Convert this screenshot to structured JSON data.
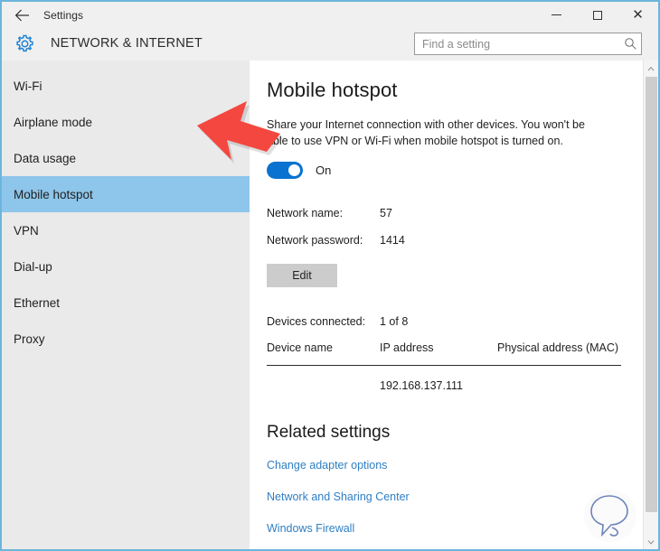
{
  "window": {
    "title": "Settings",
    "back_icon": "back-arrow-icon",
    "controls": {
      "minimize": "minimize-icon",
      "maximize": "maximize-icon",
      "close": "close-icon"
    }
  },
  "header": {
    "gear_icon": "gear-icon",
    "page_title": "NETWORK & INTERNET"
  },
  "search": {
    "placeholder": "Find a setting",
    "value": "",
    "icon": "search-icon"
  },
  "sidebar": {
    "items": [
      {
        "label": "Wi-Fi",
        "selected": false
      },
      {
        "label": "Airplane mode",
        "selected": false
      },
      {
        "label": "Data usage",
        "selected": false
      },
      {
        "label": "Mobile hotspot",
        "selected": true
      },
      {
        "label": "VPN",
        "selected": false
      },
      {
        "label": "Dial-up",
        "selected": false
      },
      {
        "label": "Ethernet",
        "selected": false
      },
      {
        "label": "Proxy",
        "selected": false
      }
    ],
    "selected_color": "#8ec5ea",
    "background": "#eaeaea"
  },
  "main": {
    "heading": "Mobile hotspot",
    "description": "Share your Internet connection with other devices. You won't be able to use VPN or Wi-Fi when mobile hotspot is turned on.",
    "toggle": {
      "state_label": "On",
      "checked": true,
      "color": "#0a72d0"
    },
    "details": [
      {
        "label": "Network name:",
        "value": "57"
      },
      {
        "label": "Network password:",
        "value": "1414"
      }
    ],
    "edit_button": "Edit",
    "devices": {
      "count_label": "Devices connected:",
      "count_value": "1 of 8",
      "columns": [
        "Device name",
        "IP address",
        "Physical address (MAC)"
      ],
      "rows": [
        {
          "device_name": "",
          "ip_address": "192.168.137.111",
          "mac": ""
        }
      ]
    },
    "related": {
      "heading": "Related settings",
      "links": [
        "Change adapter options",
        "Network and Sharing Center",
        "Windows Firewall"
      ],
      "link_color": "#2f7fc4"
    }
  },
  "scrollbar": {
    "up_arrow": "chevron-up-icon",
    "down_arrow": "chevron-down-icon"
  },
  "overlays": {
    "feedback_icon": "feedback-bubble-icon",
    "annotation_arrow": "red-arrow-annotation",
    "annotation_color": "#f4473f"
  }
}
